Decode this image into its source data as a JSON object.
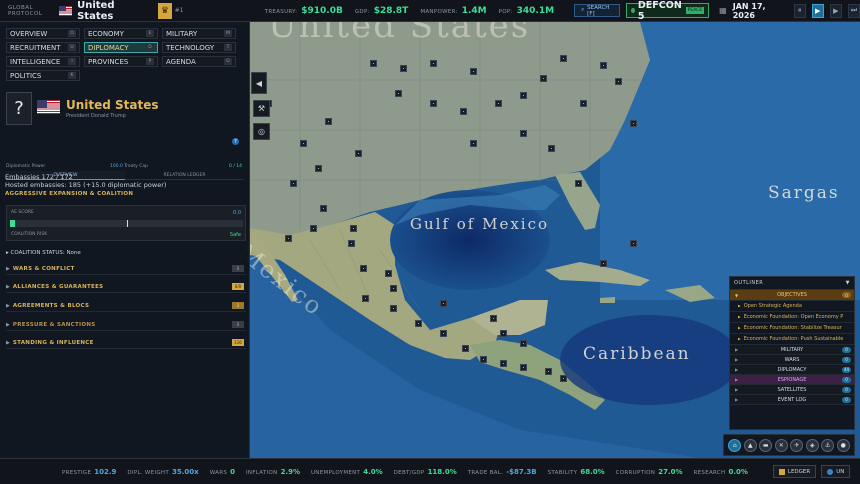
{
  "topbar": {
    "section": "GLOBAL PROTOCOL",
    "country": "United States",
    "rank": "#1",
    "stats": [
      {
        "key": "TREASURY:",
        "value": "$910.0B"
      },
      {
        "key": "GDP:",
        "value": "$28.8T"
      },
      {
        "key": "MANPOWER:",
        "value": "1.4M"
      },
      {
        "key": "POP:",
        "value": "340.1M"
      }
    ],
    "search_label": "SEARCH [F]",
    "defcon_label": "DEFCON 5",
    "defcon_status": "PEACE",
    "date": "JAN 17, 2026"
  },
  "tabs": [
    {
      "label": "OVERVIEW",
      "key": "O"
    },
    {
      "label": "ECONOMY",
      "key": "E"
    },
    {
      "label": "MILITARY",
      "key": "M"
    },
    {
      "label": "RECRUITMENT",
      "key": "U"
    },
    {
      "label": "DIPLOMACY",
      "key": "D"
    },
    {
      "label": "TECHNOLOGY",
      "key": "T"
    },
    {
      "label": "INTELLIGENCE",
      "key": "I"
    },
    {
      "label": "PROVINCES",
      "key": "P"
    },
    {
      "label": "AGENDA",
      "key": "G"
    },
    {
      "label": "POLITICS",
      "key": "K"
    }
  ],
  "country_panel": {
    "portrait": "?",
    "name": "United States",
    "leader": "President Donald Trump",
    "help": "?",
    "subtabs": [
      "OVERVIEW",
      "RELATION LEDGER"
    ],
    "diplomatic_power_label": "Diplomatic Power",
    "diplomatic_power_value": "100.0",
    "treaty_cap_label": "Treaty Cap",
    "treaty_cap_value": "0 / 14",
    "embassies": "Embassies 172 / 172",
    "hosted": "Hosted embassies: 185 (+15.0 diplomatic power)",
    "aggressive_title": "AGGRESSIVE EXPANSION & COALITION",
    "ae_score_label": "AE SCORE",
    "ae_score_value": "0.0",
    "ae_fill_fraction": 0.02,
    "coalition_risk_label": "COALITION RISK",
    "coalition_risk_value": "Safe",
    "coalition_status": "COALITION STATUS: None",
    "sections": [
      {
        "label": "WARS & CONFLICT",
        "badge": "0",
        "color": "#d8b45a",
        "badge_bg": "#3a3f46",
        "badge_fg": "#9aa6b4"
      },
      {
        "label": "ALLIANCES & GUARANTEES",
        "badge": "0/0",
        "color": "#d8b45a",
        "badge_bg": "#d4a640",
        "badge_fg": "#2a1e00"
      },
      {
        "label": "AGREEMENTS & BLOCS",
        "badge": "1",
        "color": "#d8b45a",
        "badge_bg": "#9a7a28",
        "badge_fg": "#f5e7b8"
      },
      {
        "label": "PRESSURE & SANCTIONS",
        "badge": "0",
        "color": "#b8924a",
        "badge_bg": "#3a3f46",
        "badge_fg": "#9aa6b4"
      },
      {
        "label": "STANDING & INFLUENCE",
        "badge": "116",
        "color": "#d8b45a",
        "badge_bg": "#d4a640",
        "badge_fg": "#2a1e00"
      }
    ]
  },
  "map": {
    "labels": [
      "United States",
      "Mexico",
      "Gulf of Mexico",
      "Sargas",
      "Caribbean"
    ]
  },
  "outliner": {
    "title": "OUTLINER",
    "objectives_label": "OBJECTIVES",
    "objectives_count": "0",
    "objectives": [
      "Open Strategic Agenda",
      "Economic Foundation: Open Economy P",
      "Economic Foundation: Stabilize Treasur",
      "Economic Foundation: Push Sustainable"
    ],
    "rows": [
      {
        "label": "MILITARY",
        "count": "0",
        "color": "#d6dde5",
        "bg": "#151a21"
      },
      {
        "label": "WARS",
        "count": "0",
        "color": "#d6dde5",
        "bg": "#151a21"
      },
      {
        "label": "DIPLOMACY",
        "count": "44",
        "color": "#d6dde5",
        "bg": "#151a21"
      },
      {
        "label": "ESPIONAGE",
        "count": "0",
        "color": "#d9a6f0",
        "bg": "#3a2145"
      },
      {
        "label": "SATELLITES",
        "count": "0",
        "color": "#d6dde5",
        "bg": "#151a21"
      },
      {
        "label": "EVENT LOG",
        "count": "0",
        "color": "#d6dde5",
        "bg": "#151a21"
      }
    ]
  },
  "bottombar": {
    "stats": [
      {
        "key": "PRESTIGE",
        "value": "102.9"
      },
      {
        "key": "DIPL. WEIGHT",
        "value": "35.00x"
      },
      {
        "key": "WARS",
        "value": "0"
      },
      {
        "key": "INFLATION",
        "value": "2.9%"
      },
      {
        "key": "UNEMPLOYMENT",
        "value": "4.0%"
      },
      {
        "key": "DEBT/GDP",
        "value": "118.0%"
      },
      {
        "key": "TRADE BAL.",
        "value": "-$87.3B"
      },
      {
        "key": "STABILITY",
        "value": "68.0%"
      },
      {
        "key": "CORRUPTION",
        "value": "27.0%"
      },
      {
        "key": "RESEARCH",
        "value": "0.0%"
      }
    ],
    "ledger_label": "LEDGER",
    "un_label": "UN"
  }
}
